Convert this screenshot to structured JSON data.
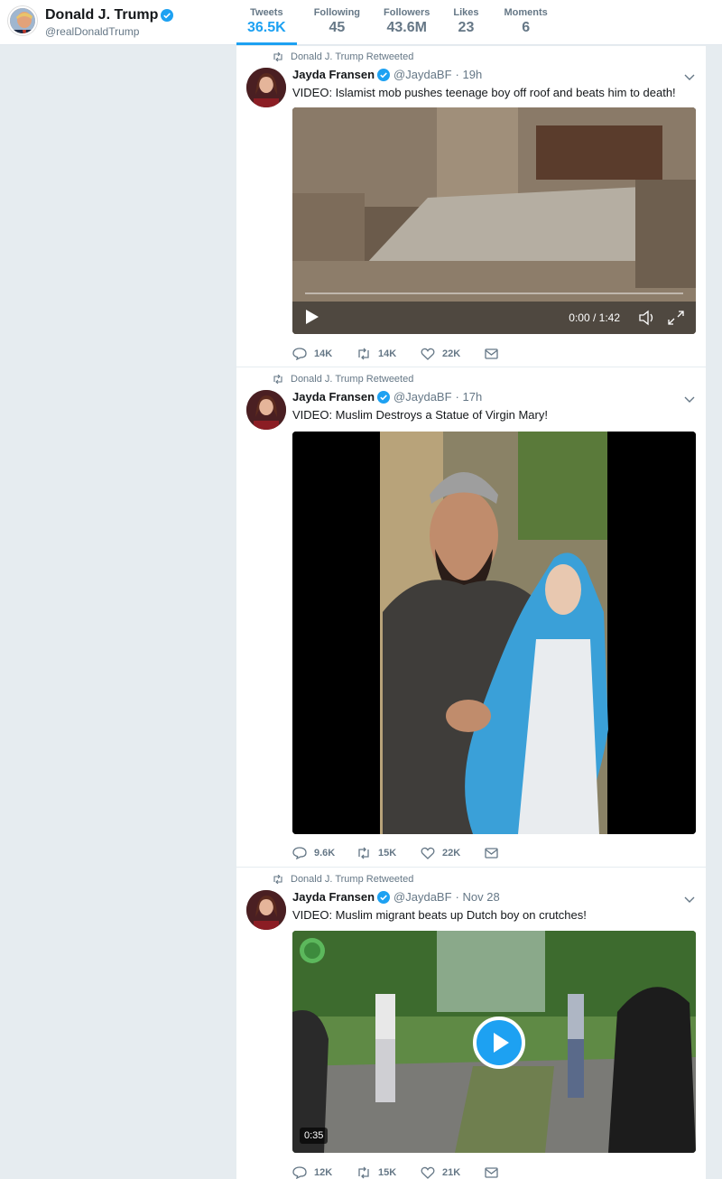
{
  "profile": {
    "name": "Donald J. Trump",
    "handle": "@realDonaldTrump"
  },
  "nav": [
    {
      "label": "Tweets",
      "value": "36.5K"
    },
    {
      "label": "Following",
      "value": "45"
    },
    {
      "label": "Followers",
      "value": "43.6M"
    },
    {
      "label": "Likes",
      "value": "23"
    },
    {
      "label": "Moments",
      "value": "6"
    }
  ],
  "colors": {
    "accent": "#1da1f2",
    "muted": "#657786",
    "background": "#e6ecf0"
  },
  "tweets": [
    {
      "retweet_label": "Donald J. Trump Retweeted",
      "author": "Jayda Fransen",
      "handle": "@JaydaBF",
      "time": "· 19h",
      "text": "VIDEO: Islamist mob pushes teenage boy off roof and beats him to death!",
      "video_time": "0:00 / 1:42",
      "replies": "14K",
      "retweets": "14K",
      "likes": "22K"
    },
    {
      "retweet_label": "Donald J. Trump Retweeted",
      "author": "Jayda Fransen",
      "handle": "@JaydaBF",
      "time": "· 17h",
      "text": "VIDEO: Muslim Destroys a Statue of Virgin Mary!",
      "replies": "9.6K",
      "retweets": "15K",
      "likes": "22K"
    },
    {
      "retweet_label": "Donald J. Trump Retweeted",
      "author": "Jayda Fransen",
      "handle": "@JaydaBF",
      "time": "· Nov 28",
      "text": "VIDEO: Muslim migrant beats up Dutch boy on crutches!",
      "video_duration": "0:35",
      "replies": "12K",
      "retweets": "15K",
      "likes": "21K"
    }
  ]
}
